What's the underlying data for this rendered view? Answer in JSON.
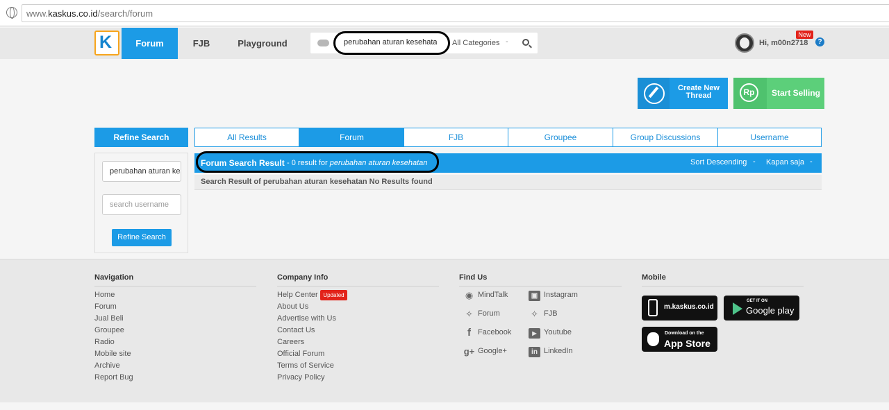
{
  "browser": {
    "url_prefix": "www.",
    "url_domain": "kaskus.co.id",
    "url_path": "/search/forum"
  },
  "nav": {
    "logo_letter": "K",
    "tabs": [
      {
        "label": "Forum"
      },
      {
        "label": "FJB"
      },
      {
        "label": "Playground"
      }
    ],
    "search_value": "perubahan aturan kesehatan",
    "category": "All Categories",
    "category_caret": "-",
    "greeting": "Hi, m00n2718",
    "new_badge": "New",
    "help": "?"
  },
  "actions": {
    "create_label": "Create New Thread",
    "sell_label": "Start Selling",
    "sell_icon_text": "Rp"
  },
  "refine": {
    "header": "Refine Search",
    "query_value": "perubahan aturan kesehatan",
    "username_placeholder": "search username",
    "button": "Refine Search"
  },
  "result_tabs": [
    {
      "label": "All Results"
    },
    {
      "label": "Forum"
    },
    {
      "label": "FJB"
    },
    {
      "label": "Groupee"
    },
    {
      "label": "Group Discussions"
    },
    {
      "label": "Username"
    }
  ],
  "results": {
    "title": "Forum Search Result",
    "count_text": "- 0 result for",
    "query": "perubahan aturan kesehatan",
    "sort": "Sort Descending",
    "sort_caret": "-",
    "time": "Kapan saja",
    "time_caret": "-",
    "empty_message": "Search Result of perubahan aturan kesehatan No Results found"
  },
  "footer": {
    "navigation": {
      "title": "Navigation",
      "links": [
        "Home",
        "Forum",
        "Jual Beli",
        "Groupee",
        "Radio",
        "Mobile site",
        "Archive",
        "Report Bug"
      ]
    },
    "company": {
      "title": "Company Info",
      "links": [
        "Help Center",
        "About Us",
        "Advertise with Us",
        "Contact Us",
        "Careers",
        "Official Forum",
        "Terms of Service",
        "Privacy Policy"
      ],
      "updated_badge": "Updated"
    },
    "findus": {
      "title": "Find Us",
      "left": [
        {
          "label": "MindTalk",
          "icon": "mindtalk-icon"
        },
        {
          "label": "Forum",
          "icon": "twitter-icon"
        },
        {
          "label": "Facebook",
          "icon": "facebook-icon"
        },
        {
          "label": "Google+",
          "icon": "googleplus-icon"
        }
      ],
      "right": [
        {
          "label": "Instagram",
          "icon": "instagram-icon"
        },
        {
          "label": "FJB",
          "icon": "twitter-icon"
        },
        {
          "label": "Youtube",
          "icon": "youtube-icon"
        },
        {
          "label": "LinkedIn",
          "icon": "linkedin-icon"
        }
      ]
    },
    "mobile": {
      "title": "Mobile",
      "mobile_site": "m.kaskus.co.id",
      "gplay_small": "GET IT ON",
      "gplay_big": "Google play",
      "appstore_small": "Download on the",
      "appstore_big": "App Store"
    }
  },
  "colors": {
    "primary": "#1c9be6",
    "sell": "#5ccf7a",
    "badge": "#e2231a",
    "logo_border": "#f7a51c"
  }
}
